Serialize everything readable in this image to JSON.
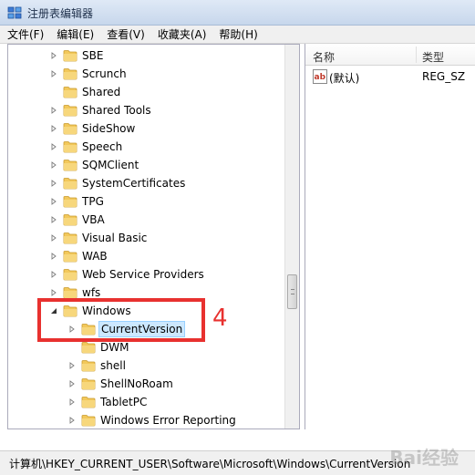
{
  "window": {
    "title": "注册表编辑器"
  },
  "menu": [
    "文件(F)",
    "编辑(E)",
    "查看(V)",
    "收藏夹(A)",
    "帮助(H)"
  ],
  "tree": {
    "nodes": [
      {
        "label": "SBE",
        "indent": 0,
        "expander": "collapsed"
      },
      {
        "label": "Scrunch",
        "indent": 0,
        "expander": "collapsed"
      },
      {
        "label": "Shared",
        "indent": 0,
        "expander": "none"
      },
      {
        "label": "Shared Tools",
        "indent": 0,
        "expander": "collapsed"
      },
      {
        "label": "SideShow",
        "indent": 0,
        "expander": "collapsed"
      },
      {
        "label": "Speech",
        "indent": 0,
        "expander": "collapsed"
      },
      {
        "label": "SQMClient",
        "indent": 0,
        "expander": "collapsed"
      },
      {
        "label": "SystemCertificates",
        "indent": 0,
        "expander": "collapsed"
      },
      {
        "label": "TPG",
        "indent": 0,
        "expander": "collapsed"
      },
      {
        "label": "VBA",
        "indent": 0,
        "expander": "collapsed"
      },
      {
        "label": "Visual Basic",
        "indent": 0,
        "expander": "collapsed"
      },
      {
        "label": "WAB",
        "indent": 0,
        "expander": "collapsed"
      },
      {
        "label": "Web Service Providers",
        "indent": 0,
        "expander": "collapsed"
      },
      {
        "label": "wfs",
        "indent": 0,
        "expander": "collapsed"
      },
      {
        "label": "Windows",
        "indent": 0,
        "expander": "expanded"
      },
      {
        "label": "CurrentVersion",
        "indent": 1,
        "expander": "collapsed",
        "selected": true
      },
      {
        "label": "DWM",
        "indent": 1,
        "expander": "none"
      },
      {
        "label": "shell",
        "indent": 1,
        "expander": "collapsed"
      },
      {
        "label": "ShellNoRoam",
        "indent": 1,
        "expander": "collapsed"
      },
      {
        "label": "TabletPC",
        "indent": 1,
        "expander": "collapsed"
      },
      {
        "label": "Windows Error Reporting",
        "indent": 1,
        "expander": "collapsed"
      }
    ]
  },
  "list": {
    "headers": {
      "name": "名称",
      "type": "类型"
    },
    "rows": [
      {
        "name": "(默认)",
        "type": "REG_SZ"
      }
    ]
  },
  "status": {
    "path": "计算机\\HKEY_CURRENT_USER\\Software\\Microsoft\\Windows\\CurrentVersion"
  },
  "annotation": {
    "number": "4",
    "color": "#e8312f"
  },
  "watermark": "Bai经验"
}
